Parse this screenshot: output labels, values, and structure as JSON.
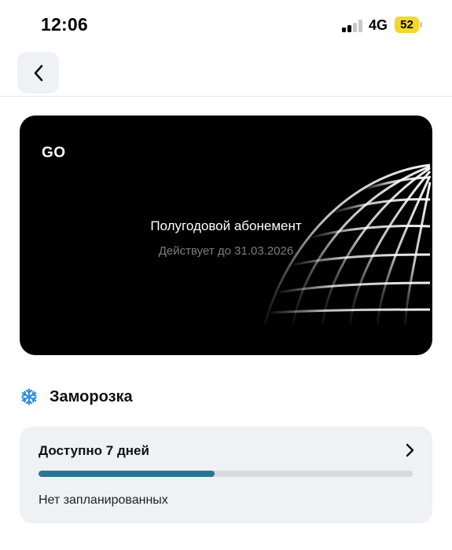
{
  "status_bar": {
    "time": "12:06",
    "network": "4G",
    "battery_level": "52",
    "battery_color": "#f2d82c",
    "signal_bars_active": 2,
    "signal_bars_total": 4
  },
  "header": {
    "back_icon": "chevron-left-icon"
  },
  "card": {
    "logo": "GO",
    "title": "Полугодовой абонемент",
    "subtitle": "Действует до 31.03.2026",
    "background": "#000000"
  },
  "freeze": {
    "icon": "snowflake-icon",
    "icon_color": "#2f8fd8",
    "title": "Заморозка",
    "available_label": "Доступно 7 дней",
    "progress_fraction": 0.47,
    "progress_color": "#2a7593",
    "status": "Нет запланированных",
    "chevron_icon": "chevron-right-icon"
  }
}
